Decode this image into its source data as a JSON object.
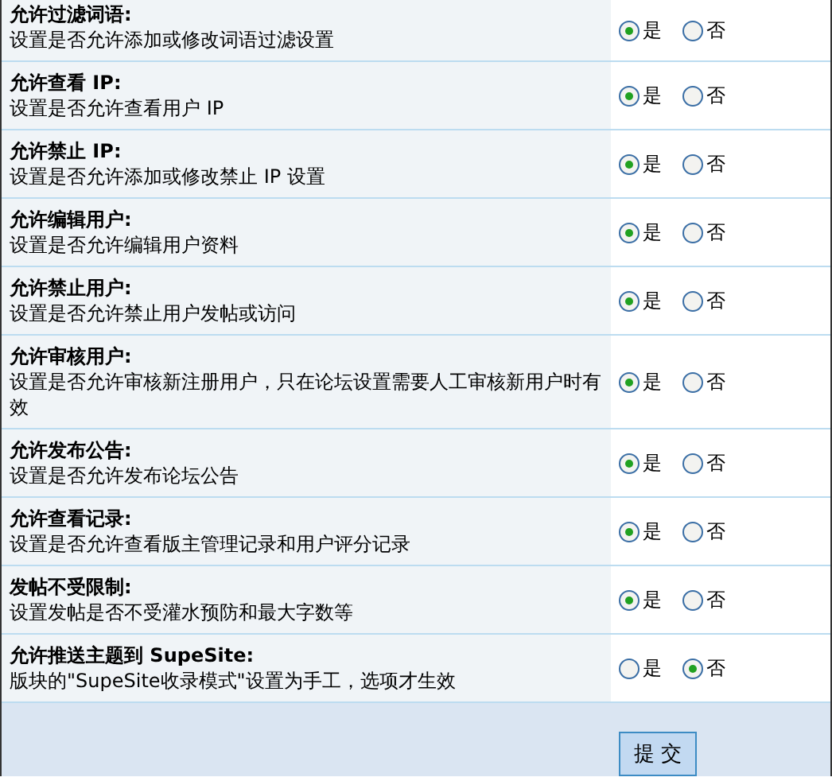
{
  "settings": [
    {
      "title": "允许过滤词语:",
      "description": "设置是否允许添加或修改词语过滤设置",
      "options": [
        {
          "label": "是",
          "selected": true
        },
        {
          "label": "否",
          "selected": false
        }
      ]
    },
    {
      "title": "允许查看 IP:",
      "description": "设置是否允许查看用户 IP",
      "options": [
        {
          "label": "是",
          "selected": true
        },
        {
          "label": "否",
          "selected": false
        }
      ]
    },
    {
      "title": "允许禁止 IP:",
      "description": "设置是否允许添加或修改禁止 IP 设置",
      "options": [
        {
          "label": "是",
          "selected": true
        },
        {
          "label": "否",
          "selected": false
        }
      ]
    },
    {
      "title": "允许编辑用户:",
      "description": "设置是否允许编辑用户资料",
      "options": [
        {
          "label": "是",
          "selected": true
        },
        {
          "label": "否",
          "selected": false
        }
      ]
    },
    {
      "title": "允许禁止用户:",
      "description": "设置是否允许禁止用户发帖或访问",
      "options": [
        {
          "label": "是",
          "selected": true
        },
        {
          "label": "否",
          "selected": false
        }
      ]
    },
    {
      "title": "允许审核用户:",
      "description": "设置是否允许审核新注册用户，只在论坛设置需要人工审核新用户时有效",
      "options": [
        {
          "label": "是",
          "selected": true
        },
        {
          "label": "否",
          "selected": false
        }
      ]
    },
    {
      "title": "允许发布公告:",
      "description": "设置是否允许发布论坛公告",
      "options": [
        {
          "label": "是",
          "selected": true
        },
        {
          "label": "否",
          "selected": false
        }
      ]
    },
    {
      "title": "允许查看记录:",
      "description": "设置是否允许查看版主管理记录和用户评分记录",
      "options": [
        {
          "label": "是",
          "selected": true
        },
        {
          "label": "否",
          "selected": false
        }
      ]
    },
    {
      "title": "发帖不受限制:",
      "description": "设置发帖是否不受灌水预防和最大字数等",
      "options": [
        {
          "label": "是",
          "selected": true
        },
        {
          "label": "否",
          "selected": false
        }
      ]
    },
    {
      "title": "允许推送主题到 SupeSite:",
      "description": "版块的\"SupeSite收录模式\"设置为手工，选项才生效",
      "options": [
        {
          "label": "是",
          "selected": false
        },
        {
          "label": "否",
          "selected": true
        }
      ]
    }
  ],
  "submit_button": "提 交"
}
